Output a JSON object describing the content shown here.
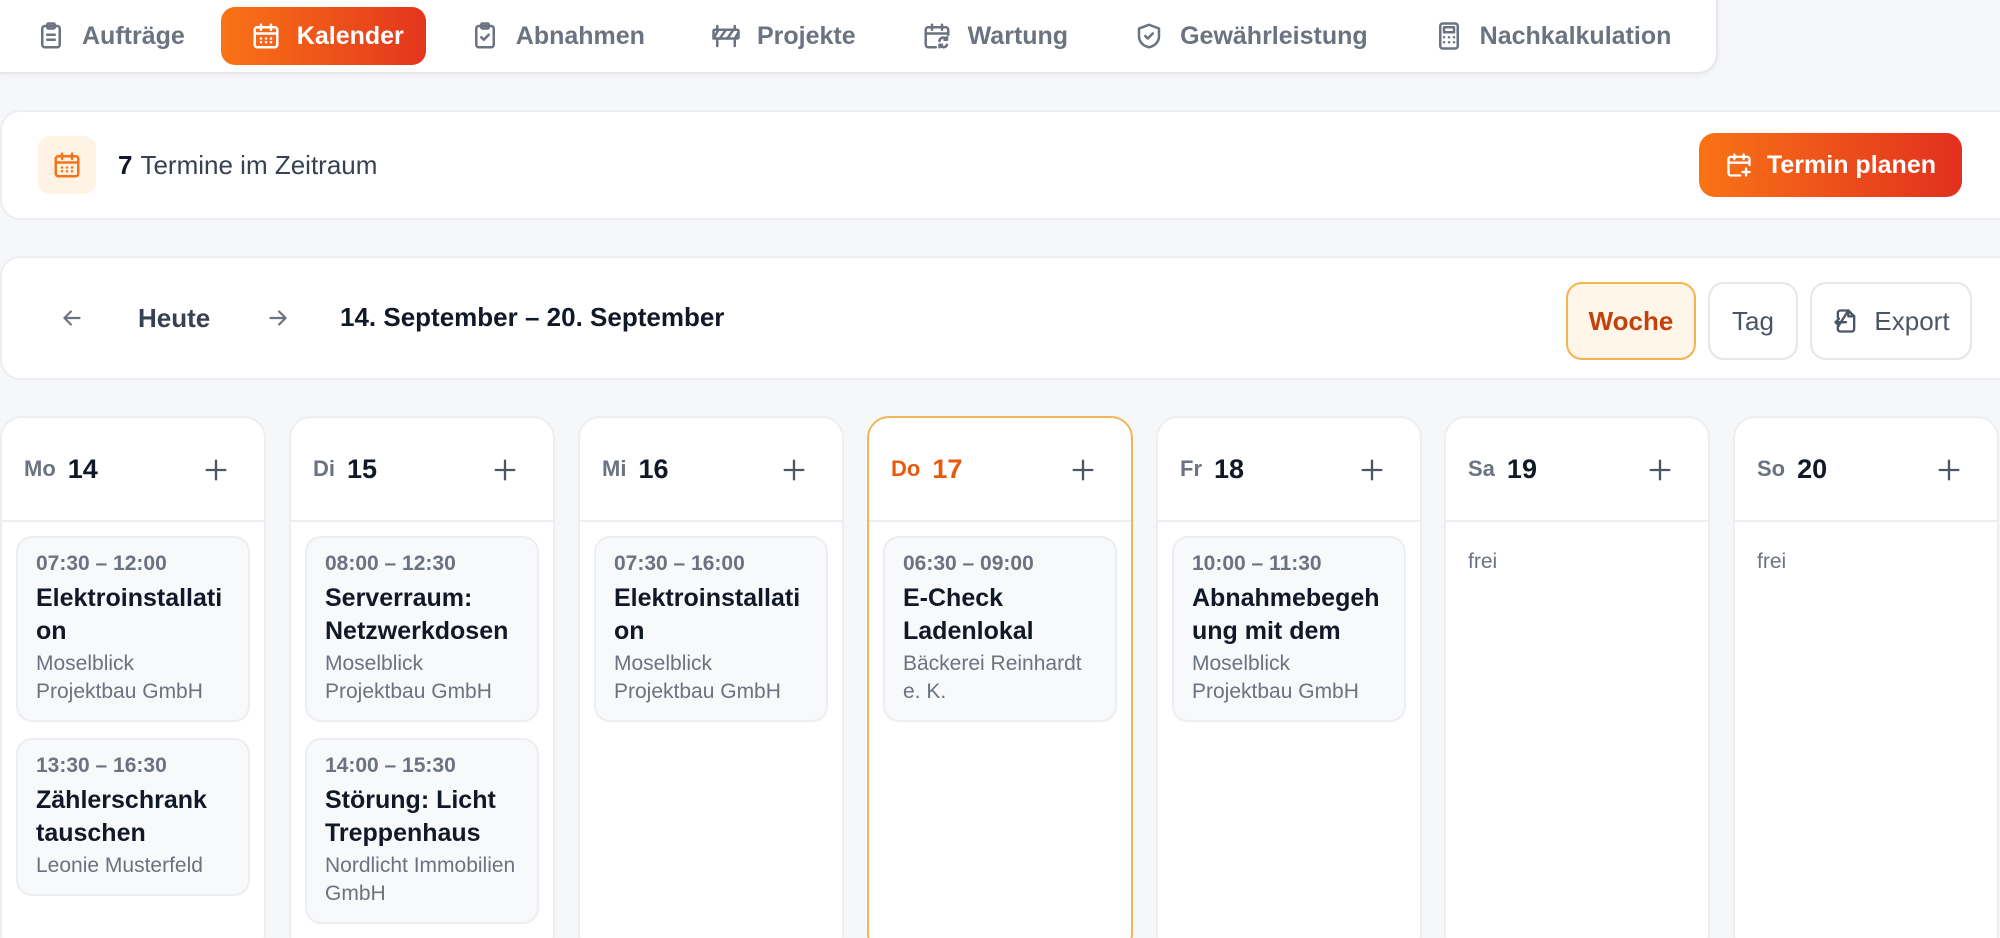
{
  "nav": {
    "tabs": [
      {
        "label": "Aufträge",
        "icon": "clipboard-list-icon",
        "active": false
      },
      {
        "label": "Kalender",
        "icon": "calendar-icon",
        "active": true
      },
      {
        "label": "Abnahmen",
        "icon": "clipboard-check-icon",
        "active": false
      },
      {
        "label": "Projekte",
        "icon": "construction-barrier-icon",
        "active": false
      },
      {
        "label": "Wartung",
        "icon": "calendar-refresh-icon",
        "active": false
      },
      {
        "label": "Gewährleistung",
        "icon": "shield-check-icon",
        "active": false
      },
      {
        "label": "Nachkalkulation",
        "icon": "calculator-icon",
        "active": false
      }
    ]
  },
  "summary": {
    "count": "7",
    "text": "Termine im Zeitraum",
    "plan_label": "Termin planen"
  },
  "toolbar": {
    "today_label": "Heute",
    "range": "14. September – 20. September",
    "week_label": "Woche",
    "day_label": "Tag",
    "export_label": "Export"
  },
  "days": [
    {
      "name": "Mo",
      "num": "14",
      "today": false,
      "events": [
        {
          "time": "07:30 – 12:00",
          "title": "Elektroinstallation Obergeschoss",
          "client": "Moselblick Projektbau GmbH"
        },
        {
          "time": "13:30 – 16:30",
          "title": "Zählerschrank tauschen",
          "client": "Leonie Musterfeld"
        }
      ]
    },
    {
      "name": "Di",
      "num": "15",
      "today": false,
      "events": [
        {
          "time": "08:00 – 12:30",
          "title": "Serverraum: Netzwerkdosen",
          "client": "Moselblick Projektbau GmbH"
        },
        {
          "time": "14:00 – 15:30",
          "title": "Störung: Licht Treppenhaus",
          "client": "Nordlicht Immobilien GmbH"
        }
      ]
    },
    {
      "name": "Mi",
      "num": "16",
      "today": false,
      "events": [
        {
          "time": "07:30 – 16:00",
          "title": "Elektroinstallation Obergeschoss",
          "client": "Moselblick Projektbau GmbH"
        }
      ]
    },
    {
      "name": "Do",
      "num": "17",
      "today": true,
      "events": [
        {
          "time": "06:30 – 09:00",
          "title": "E-Check Ladenlokal",
          "client": "Bäckerei Reinhardt e. K."
        }
      ]
    },
    {
      "name": "Fr",
      "num": "18",
      "today": false,
      "events": [
        {
          "time": "10:00 – 11:30",
          "title": "Abnahmebegehung mit dem Bauherrn",
          "client": "Moselblick Projektbau GmbH"
        }
      ]
    },
    {
      "name": "Sa",
      "num": "19",
      "today": false,
      "free_label": "frei",
      "events": []
    },
    {
      "name": "So",
      "num": "20",
      "today": false,
      "free_label": "frei",
      "events": []
    }
  ],
  "colors": {
    "accent_start": "#f97316",
    "accent_end": "#e1301f",
    "today_border": "#f4b457",
    "today_text": "#ea580c"
  }
}
